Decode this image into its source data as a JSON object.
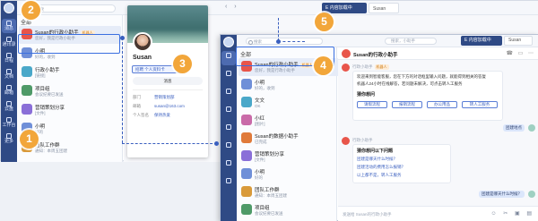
{
  "bg": {
    "search_placeholder": "搜索",
    "nav_arrows": "‹  ›",
    "tabs": [
      {
        "label": "E 内容加载中",
        "active": true
      },
      {
        "label": "Susan",
        "active": false
      }
    ],
    "rail": [
      {
        "label": "消息"
      },
      {
        "label": "通讯录"
      },
      {
        "label": "日程"
      },
      {
        "label": "文档"
      },
      {
        "label": "邮箱"
      },
      {
        "label": "云盘"
      },
      {
        "label": "工作台"
      },
      {
        "label": "更多"
      }
    ],
    "list_title": "全部",
    "contacts": [
      {
        "name": "Susan的行政小助手",
        "tag": "机器人",
        "msg": "您好，我是行政小助手",
        "time": "",
        "color": "#e8554a",
        "selected": true
      },
      {
        "name": "小明",
        "tag": "",
        "msg": "好的，收到",
        "time": "",
        "color": "#6f8fd8",
        "selected": false
      },
      {
        "name": "行政小助手",
        "tag": "",
        "msg": "[链接]",
        "time": "",
        "color": "#4aa8c9",
        "selected": false
      },
      {
        "name": "项目组",
        "tag": "",
        "msg": "会议纪要已发送",
        "time": "",
        "color": "#4f9a68",
        "selected": false
      },
      {
        "name": "营销策划分享",
        "tag": "",
        "msg": "[文件]",
        "time": "",
        "color": "#8a6fd8",
        "selected": false
      },
      {
        "name": "小明",
        "tag": "",
        "msg": "好的",
        "time": "",
        "color": "#6f8fd8",
        "selected": false
      },
      {
        "name": "团队工作群",
        "tag": "",
        "msg": "通知：本周五团建",
        "time": "",
        "color": "#d99a3a",
        "selected": false
      }
    ]
  },
  "card": {
    "name": "Susan",
    "chip": "招聘 个人资料卡",
    "message_button": "消息",
    "rows": [
      {
        "label": "部门",
        "value": "营销策划部"
      },
      {
        "label": "邮箱",
        "value": "susan@163.com"
      },
      {
        "label": "个人签名",
        "value": "保持热爱"
      }
    ]
  },
  "fg": {
    "search_placeholder": "搜索",
    "center_search": "搜索，小助手",
    "tabs": [
      {
        "label": "E 内容加载中",
        "active": true
      },
      {
        "label": "Susan",
        "active": false
      }
    ],
    "list_title": "全部",
    "contacts": [
      {
        "name": "Susan的行政小助手",
        "tag": "机器人",
        "msg": "您好，我是行政小助手",
        "color": "#e8554a",
        "selected": true
      },
      {
        "name": "小明",
        "tag": "",
        "msg": "好的，收到",
        "color": "#6f8fd8",
        "selected": false
      },
      {
        "name": "文文",
        "tag": "",
        "msg": "OK",
        "color": "#4aa8c9",
        "selected": false
      },
      {
        "name": "小红",
        "tag": "",
        "msg": "[图片]",
        "color": "#c96aa8",
        "selected": false
      },
      {
        "name": "Susan的数据小助手",
        "tag": "",
        "msg": "已完成",
        "color": "#e07a3a",
        "selected": false
      },
      {
        "name": "营销策划分享",
        "tag": "",
        "msg": "[文件]",
        "color": "#8a6fd8",
        "selected": false
      },
      {
        "name": "小明",
        "tag": "",
        "msg": "好的",
        "color": "#6f8fd8",
        "selected": false
      },
      {
        "name": "团队工作群",
        "tag": "",
        "msg": "通知：本周五团建",
        "color": "#d99a3a",
        "selected": false
      },
      {
        "name": "项目组",
        "tag": "",
        "msg": "会议纪要已发送",
        "color": "#4f9a68",
        "selected": false
      }
    ],
    "chat": {
      "title": "Susan的行政小助手",
      "bot_meta": "行政小助手",
      "bot_tag": "机器人",
      "intro_lines": [
        "欢迎来到智能客服，您在下方的对话框里输入问题，就能得到相关的答复",
        "机器人24小时在线解答，若问题未解决，可点击转人工服务"
      ],
      "intro_bold": "猜你想问",
      "quick": [
        "请假流程",
        "报销流程",
        "办公用品",
        "转人工服务"
      ],
      "me_msg": "团建地点",
      "bot2_meta": "行政小助手",
      "bot2_title": "猜你想问以下问题",
      "links": [
        "团建是哪天什么时候？",
        "团建活动的费用怎么报销？",
        "以上都不是，转人工服务"
      ],
      "me_msg2": "团建是哪天什么时候？",
      "composer_placeholder": "发送给 Susan的行政小助手"
    }
  },
  "badges": [
    "1",
    "2",
    "3",
    "4",
    "5"
  ]
}
